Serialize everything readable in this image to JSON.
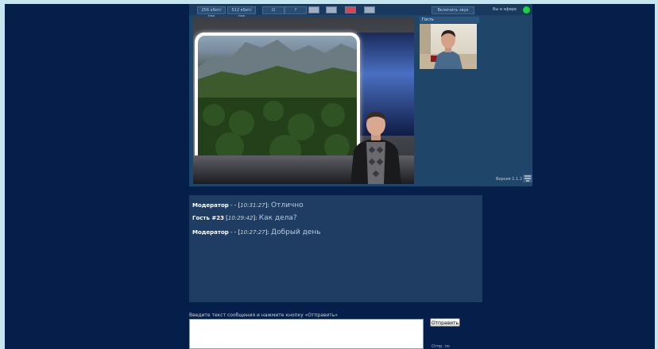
{
  "toolbar": {
    "btn_1": "256 кбит/сек",
    "btn_2": "512 кбит/сек",
    "btn_3": "⊡",
    "btn_4": "?",
    "btn_microphone": "Включить звук",
    "onair_label": "Вы в эфире"
  },
  "guest": {
    "label": "Гость"
  },
  "version": "Версия 1.1.2",
  "chat": {
    "messages": [
      {
        "author": "Модератор",
        "sep": " - - [",
        "time": "10:31:27",
        "close": "]: ",
        "text": "Отлично"
      },
      {
        "author": "Гость #23",
        "sep": " [",
        "time": "10:29:42",
        "close": "]: ",
        "text": "Как дела?"
      },
      {
        "author": "Модератор",
        "sep": " - - [",
        "time": "10:27:27",
        "close": "]: ",
        "text": "Добрый день"
      }
    ]
  },
  "compose": {
    "prompt": "Введите текст сообщения и нажмите кнопку «Отправить»",
    "send_label": "Отправить",
    "link_label": "Отпр. по"
  }
}
